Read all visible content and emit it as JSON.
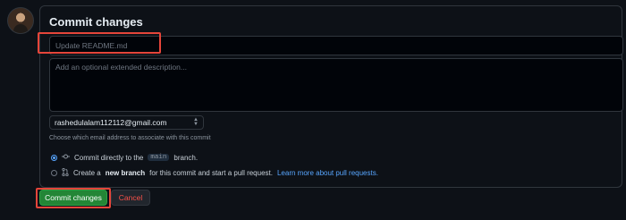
{
  "form": {
    "title": "Commit changes",
    "summary_placeholder": "Update README.md",
    "description_placeholder": "Add an optional extended description...",
    "email_selected": "rashedulalam112112@gmail.com",
    "email_help": "Choose which email address to associate with this commit"
  },
  "options": {
    "direct": {
      "prefix": "Commit directly to the",
      "branch": "main",
      "suffix": "branch."
    },
    "new_branch": {
      "prefix": "Create a",
      "bold": "new branch",
      "suffix": "for this commit and start a pull request.",
      "link": "Learn more about pull requests."
    },
    "selected": "direct"
  },
  "actions": {
    "commit_label": "Commit changes",
    "cancel_label": "Cancel"
  },
  "colors": {
    "primary_button": "#238636",
    "cancel_text": "#f85149",
    "link": "#58a6ff",
    "highlight": "#e5453a"
  },
  "icons": {
    "avatar": "user-avatar",
    "direct_commit": "git-commit-icon",
    "new_branch": "git-pull-request-icon",
    "select": "select-arrows-icon"
  }
}
